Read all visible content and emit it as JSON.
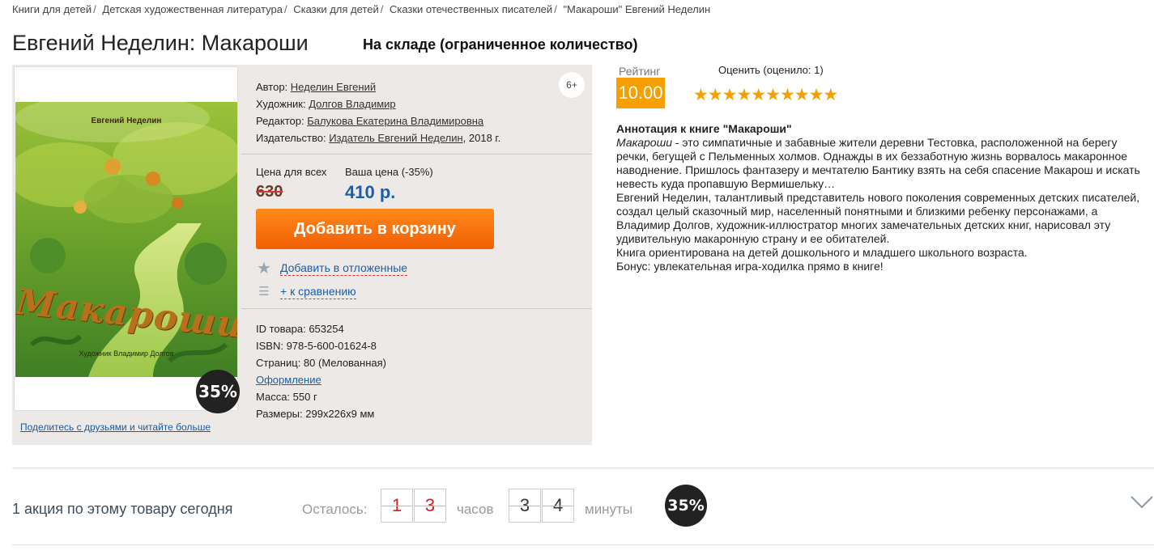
{
  "breadcrumb": [
    "Книги для детей",
    "Детская художественная литература",
    "Сказки для детей",
    "Сказки отечественных писателей",
    "\"Макароши\" Евгений Неделин"
  ],
  "title": "Евгений Неделин: Макароши",
  "stock_status": "На складе (ограниченное количество)",
  "cover": {
    "author": "Евгений Неделин",
    "title": "Макароши",
    "illustrator": "Художник Владимир Долгов",
    "discount_badge": "35%"
  },
  "share_link": "Поделитесь с друзьями и читайте больше",
  "age_rating": "6+",
  "meta": {
    "author_label": "Автор:",
    "author": "Неделин Евгений",
    "artist_label": "Художник:",
    "artist": "Долгов Владимир",
    "editor_label": "Редактор:",
    "editor": "Балукова Екатерина Владимировна",
    "publisher_label": "Издательство:",
    "publisher": "Издатель Евгений Неделин",
    "year": ", 2018 г."
  },
  "price": {
    "old_label": "Цена для всех",
    "old_value": "630",
    "new_label": "Ваша цена (-35%)",
    "new_value": "410 р."
  },
  "cart_button": "Добавить в корзину",
  "actions": {
    "wishlist_icon": "star-icon",
    "wishlist": "Добавить в отложенные",
    "compare_icon": "list-icon",
    "compare": "+ к сравнению"
  },
  "specs": {
    "id": "ID товара: 653254",
    "isbn": "ISBN: 978-5-600-01624-8",
    "pages": "Страниц: 80 (Мелованная)",
    "design_link": "Оформление",
    "weight": "Масса: 550 г",
    "dimensions": "Размеры: 299x226x9 мм"
  },
  "rating": {
    "label": "Рейтинг",
    "value": "10.00",
    "rate_label": "Оценить (оценило: 1)",
    "stars": "★★★★★★★★★★",
    "star_count": 10
  },
  "annotation": {
    "heading": "Аннотация к книге \"Макароши\"",
    "lead_italic": "Макароши",
    "lead_rest": " - это симпатичные и забавные жители деревни Тестовка, расположенной на берегу речки, бегущей с Пельменных холмов. Однажды в их беззаботную жизнь ворвалось макаронное наводнение. Пришлось фантазеру и мечтателю Бантику взять на себя спасение Макарош и искать невесть куда пропавшую Вермишельку…",
    "p2": "Евгений Неделин, талантливый представитель нового поколения современных детских писателей, создал целый сказочный мир, населенный понятными и близкими ребенку персонажами, а Владимир Долгов, художник-иллюстратор многих замечательных детских книг, нарисовал эту удивительную макаронную страну и ее обитателей.",
    "p3": "Книга ориентирована на детей дошкольного и младшего школьного возраста.",
    "p4": "Бонус: увлекательная игра-ходилка прямо в книге!"
  },
  "promo": {
    "text": "1 акция по этому товару сегодня",
    "remaining_label": "Осталось:",
    "hours_digits": [
      "1",
      "3"
    ],
    "hours_label": "часов",
    "minutes_digits": [
      "3",
      "4"
    ],
    "minutes_label": "минуты",
    "badge": "35%",
    "expand_icon": "chevron-down-icon"
  },
  "colors": {
    "accent_orange": "#f56a0a",
    "rating_orange": "#f5a000",
    "price_blue": "#1a5ea8",
    "panel_bg": "#ece9e6"
  }
}
